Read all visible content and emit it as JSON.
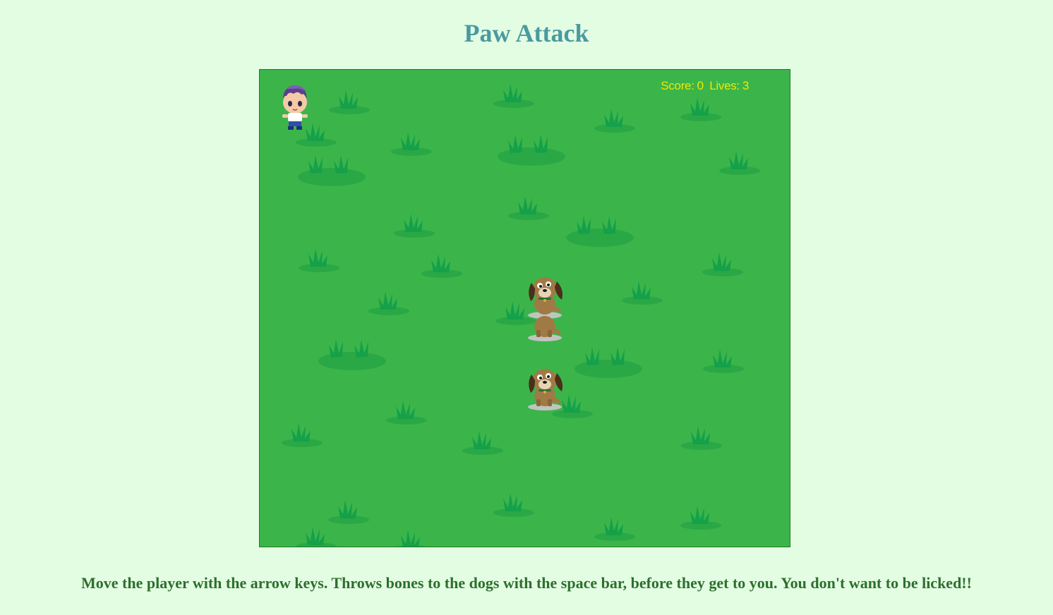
{
  "page": {
    "title": "Paw Attack",
    "instructions": "Move the player with the arrow keys. Throws bones to the dogs with the space bar, before they get to you. You don't want to be licked!!"
  },
  "hud": {
    "score_label": "Score:",
    "score": "0",
    "lives_label": "Lives:",
    "lives": "3"
  },
  "sprites": {
    "player": "player-icon",
    "dogs": [
      "dog-icon",
      "dog-icon",
      "dog-icon"
    ]
  },
  "colors": {
    "page_background": "#e3fde3",
    "field": "#3bb54a",
    "grass": "#17a04a",
    "hud_text": "#f2e600",
    "title": "#4a9aa0",
    "instructions": "#2d6f2d"
  }
}
